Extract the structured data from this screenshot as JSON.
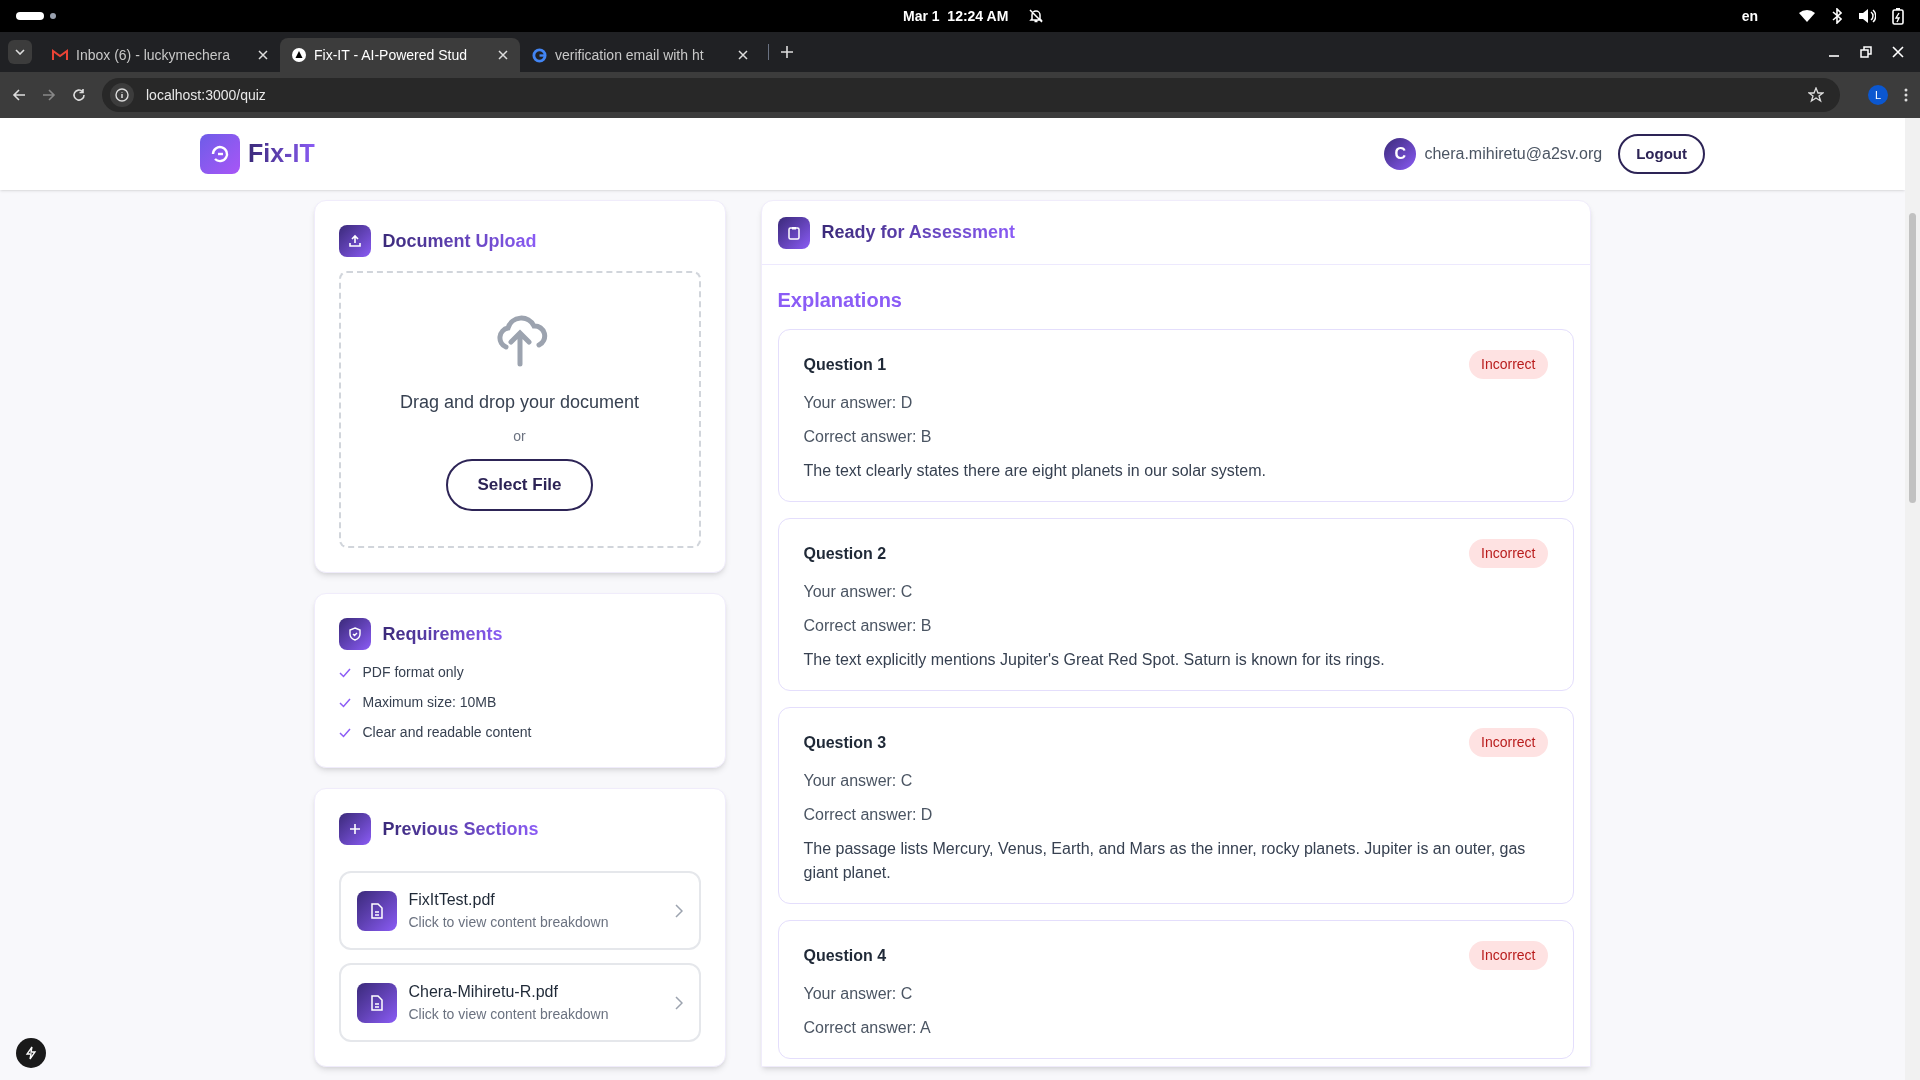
{
  "system_bar": {
    "date": "Mar 1",
    "time": "12:24 AM",
    "language": "en"
  },
  "browser": {
    "tabs": [
      {
        "title": "Inbox (6) - luckymechera",
        "selected": false
      },
      {
        "title": "Fix-IT - AI-Powered Stud",
        "selected": true
      },
      {
        "title": "verification email with ht",
        "selected": false
      }
    ],
    "url": "localhost:3000/quiz",
    "profile": "L"
  },
  "header": {
    "logo": "Fix-IT",
    "avatar": "C",
    "email": "chera.mihiretu@a2sv.org",
    "logout": "Logout"
  },
  "upload": {
    "title": "Document Upload",
    "prompt": "Drag and drop your document",
    "or": "or",
    "button": "Select File"
  },
  "requirements": {
    "title": "Requirements",
    "items": [
      "PDF format only",
      "Maximum size: 10MB",
      "Clear and readable content"
    ]
  },
  "previous": {
    "title": "Previous Sections",
    "items": [
      {
        "name": "FixItTest.pdf",
        "hint": "Click to view content breakdown"
      },
      {
        "name": "Chera-Mihiretu-R.pdf",
        "hint": "Click to view content breakdown"
      }
    ]
  },
  "assessment": {
    "title": "Ready for Assessment",
    "section": "Explanations",
    "questions": [
      {
        "title": "Question 1",
        "status": "Incorrect",
        "correct": false,
        "your_answer": "Your answer: D",
        "correct_answer": "Correct answer: B",
        "explanation": "The text clearly states there are eight planets in our solar system."
      },
      {
        "title": "Question 2",
        "status": "Incorrect",
        "correct": false,
        "your_answer": "Your answer: C",
        "correct_answer": "Correct answer: B",
        "explanation": "The text explicitly mentions Jupiter's Great Red Spot. Saturn is known for its rings."
      },
      {
        "title": "Question 3",
        "status": "Incorrect",
        "correct": false,
        "your_answer": "Your answer: C",
        "correct_answer": "Correct answer: D",
        "explanation": "The passage lists Mercury, Venus, Earth, and Mars as the inner, rocky planets. Jupiter is an outer, gas giant planet."
      },
      {
        "title": "Question 4",
        "status": "Incorrect",
        "correct": false,
        "your_answer": "Your answer: C",
        "correct_answer": "Correct answer: A"
      }
    ]
  }
}
